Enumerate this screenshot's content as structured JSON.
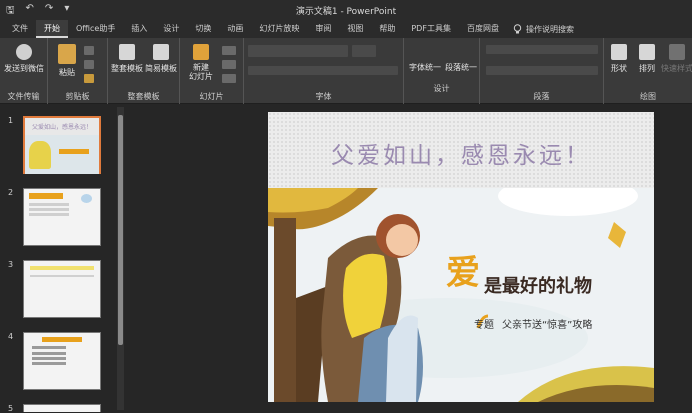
{
  "window": {
    "title": "演示文稿1 - PowerPoint"
  },
  "qat": {
    "save": "🖫",
    "undo": "↶",
    "redo": "↷",
    "custom": "▾"
  },
  "tabs": [
    "文件",
    "开始",
    "Office助手",
    "插入",
    "设计",
    "切换",
    "动画",
    "幻灯片放映",
    "审阅",
    "视图",
    "帮助",
    "PDF工具集",
    "百度网盘"
  ],
  "active_tab": "开始",
  "tell_me": "操作说明搜索",
  "ribbon": {
    "send_label": "发送到微信",
    "group_file": "文件传输",
    "paste_label": "粘贴",
    "group_clipboard": "剪贴板",
    "template_full": "整套模板",
    "template_simple": "简易模板",
    "group_template": "整套模板",
    "new_slide": "新建\n幻灯片",
    "group_slides": "幻灯片",
    "group_font": "字体",
    "font_unify": "字体统一",
    "para_unify": "段落统一",
    "group_design": "设计",
    "group_paragraph": "段落",
    "shape": "形状",
    "arrange": "排列",
    "quick_style": "快速样式",
    "group_draw": "绘图"
  },
  "slides": {
    "numbers": [
      "1",
      "2",
      "3",
      "4",
      "5"
    ]
  },
  "thumb1": {
    "title": "父爱如山，感恩永远！"
  },
  "slide": {
    "title": "父爱如山，感恩永远！",
    "big_char": "爱",
    "slogan": "是最好的礼物",
    "sub_prefix": "专题",
    "sub_main": "父亲节送“惊喜”攻略"
  },
  "colors": {
    "accent": "#e07a3c",
    "title_text": "#9a8ab0",
    "gold": "#e8a11c"
  }
}
